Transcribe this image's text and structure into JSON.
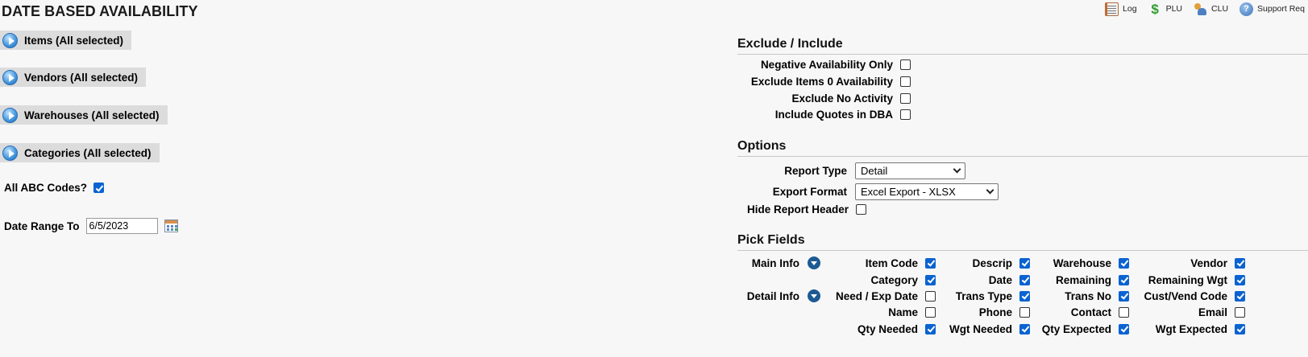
{
  "title": "DATE BASED AVAILABILITY",
  "toolbar": [
    {
      "label": "Log",
      "icon": "log-icon"
    },
    {
      "label": "PLU",
      "icon": "dollar-icon"
    },
    {
      "label": "CLU",
      "icon": "users-icon"
    },
    {
      "label": "Support Req",
      "icon": "help-icon"
    }
  ],
  "sections": [
    {
      "label": "Items (All selected)"
    },
    {
      "label": "Vendors (All selected)"
    },
    {
      "label": "Warehouses (All selected)"
    },
    {
      "label": "Categories (All selected)"
    }
  ],
  "abc": {
    "label": "All ABC Codes?",
    "checked": true
  },
  "date_range": {
    "label": "Date Range To",
    "value": "6/5/2023"
  },
  "exclude_include": {
    "heading": "Exclude / Include",
    "options": [
      {
        "label": "Negative Availability Only",
        "checked": false
      },
      {
        "label": "Exclude Items 0 Availability",
        "checked": false
      },
      {
        "label": "Exclude No Activity",
        "checked": false
      },
      {
        "label": "Include Quotes in DBA",
        "checked": false
      }
    ]
  },
  "options": {
    "heading": "Options",
    "report_type": {
      "label": "Report Type",
      "value": "Detail"
    },
    "export_format": {
      "label": "Export Format",
      "value": "Excel Export - XLSX"
    },
    "hide_header": {
      "label": "Hide Report Header",
      "checked": false
    }
  },
  "pick_fields": {
    "heading": "Pick Fields",
    "groups": [
      {
        "label": "Main Info",
        "icon": "expand-icon"
      },
      {
        "label": "Detail Info",
        "icon": "expand-icon"
      }
    ],
    "rows": [
      [
        {
          "label": "Item Code",
          "checked": true
        },
        {
          "label": "Descrip",
          "checked": true
        },
        {
          "label": "Warehouse",
          "checked": true
        },
        {
          "label": "Vendor",
          "checked": true
        }
      ],
      [
        {
          "label": "Category",
          "checked": true
        },
        {
          "label": "Date",
          "checked": true
        },
        {
          "label": "Remaining",
          "checked": true
        },
        {
          "label": "Remaining Wgt",
          "checked": true
        }
      ],
      [
        {
          "label": "Need / Exp Date",
          "checked": false
        },
        {
          "label": "Trans Type",
          "checked": true
        },
        {
          "label": "Trans No",
          "checked": true
        },
        {
          "label": "Cust/Vend Code",
          "checked": true
        }
      ],
      [
        {
          "label": "Name",
          "checked": false
        },
        {
          "label": "Phone",
          "checked": false
        },
        {
          "label": "Contact",
          "checked": false
        },
        {
          "label": "Email",
          "checked": false
        }
      ],
      [
        {
          "label": "Qty Needed",
          "checked": true
        },
        {
          "label": "Wgt Needed",
          "checked": true
        },
        {
          "label": "Qty Expected",
          "checked": true
        },
        {
          "label": "Wgt Expected",
          "checked": true
        }
      ]
    ]
  }
}
